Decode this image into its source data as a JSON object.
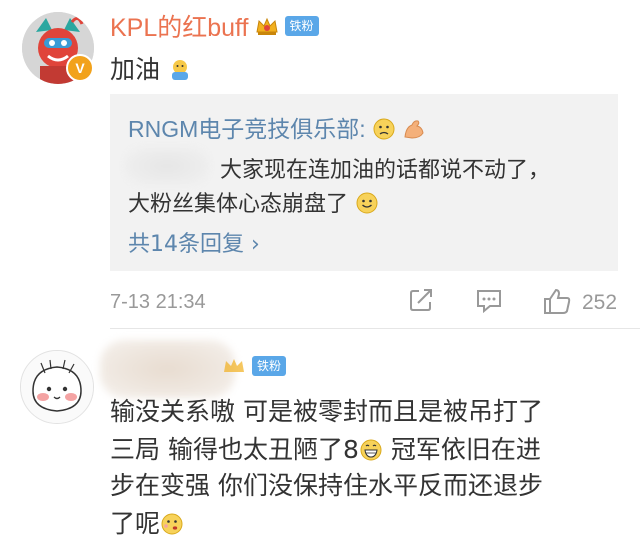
{
  "comment1": {
    "username": "KPL的红buff",
    "fan_badge": "铁粉",
    "text": "加油",
    "verified_badge": "V",
    "icons": [
      "crown-icon",
      "pray-emoji"
    ]
  },
  "reply": {
    "username": "RNGM电子竞技俱乐部:",
    "line1": "大家现在连加油的话都说不动了，",
    "line2": "大粉丝集体心态崩盘了",
    "more": "共14条回复 ›",
    "icons": [
      "worried-emoji",
      "strong-arm-emoji",
      "smile-emoji"
    ]
  },
  "meta": {
    "timestamp": "7-13 21:34",
    "likes": "252",
    "icons": [
      "share-icon",
      "comment-icon",
      "like-icon"
    ]
  },
  "comment2": {
    "fan_badge": "铁粉",
    "lines": [
      "输没关系嗷 可是被零封而且是被吊打了",
      "三局 输得也太丑陋了8",
      "冠军依旧在进",
      "步在变强 你们没保持住水平反而还退步",
      "了呢"
    ],
    "icons": [
      "grin-emoji",
      "thinking-emoji"
    ]
  },
  "colors": {
    "username": "#eb7350",
    "link": "#5d86ad",
    "badge": "#5aa7e8",
    "muted": "#999999",
    "reply_bg": "#f2f2f2"
  }
}
